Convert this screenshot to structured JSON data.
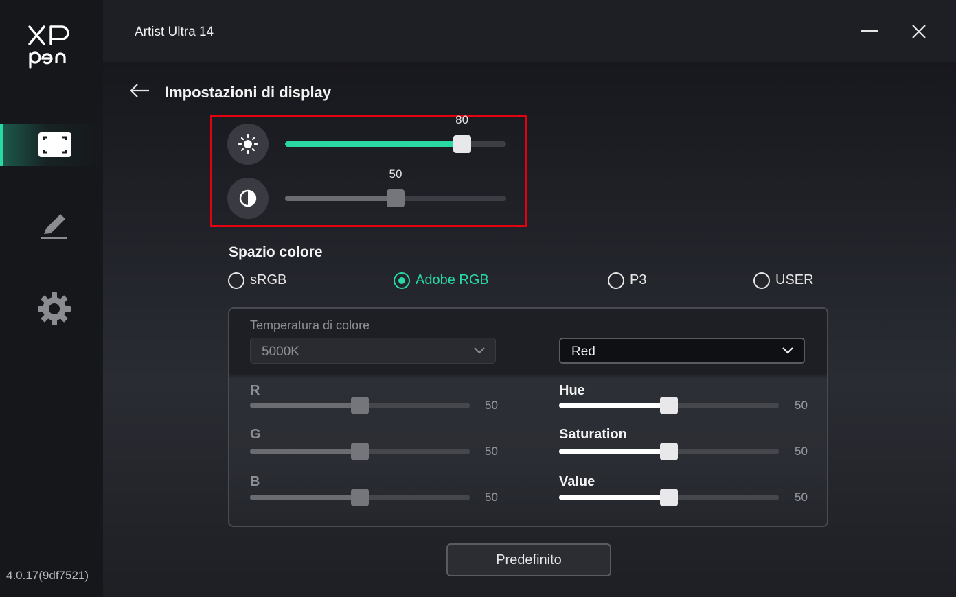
{
  "app": {
    "brand_line1": "XP",
    "brand_line2": "pen",
    "version": "4.0.17(9df7521)",
    "device_title": "Artist Ultra 14"
  },
  "sidebar": {
    "items": [
      {
        "name": "display-settings",
        "icon": "display-frame-icon",
        "active": true
      },
      {
        "name": "pen-settings",
        "icon": "pen-icon",
        "active": false
      },
      {
        "name": "general-settings",
        "icon": "gear-icon",
        "active": false
      }
    ]
  },
  "window_controls": {
    "minimize_icon": "minimize-icon",
    "close_icon": "close-icon"
  },
  "page": {
    "title": "Impostazioni di display",
    "back_icon": "back-arrow-icon"
  },
  "brightness": {
    "icon": "sun-icon",
    "value": 80,
    "value_label": "80",
    "max": 100
  },
  "contrast": {
    "icon": "contrast-icon",
    "value": 50,
    "value_label": "50",
    "max": 100
  },
  "color_space": {
    "title": "Spazio colore",
    "options": [
      {
        "label": "sRGB",
        "selected": false
      },
      {
        "label": "Adobe RGB",
        "selected": true
      },
      {
        "label": "P3",
        "selected": false
      },
      {
        "label": "USER",
        "selected": false
      }
    ]
  },
  "temperature": {
    "label": "Temperatura di colore",
    "value": "5000K"
  },
  "rgb": [
    {
      "label": "R",
      "value": 50,
      "value_label": "50"
    },
    {
      "label": "G",
      "value": 50,
      "value_label": "50"
    },
    {
      "label": "B",
      "value": 50,
      "value_label": "50"
    }
  ],
  "channel": {
    "value": "Red"
  },
  "hsv": [
    {
      "label": "Hue",
      "value": 50,
      "value_label": "50"
    },
    {
      "label": "Saturation",
      "value": 50,
      "value_label": "50"
    },
    {
      "label": "Value",
      "value": 50,
      "value_label": "50"
    }
  ],
  "default_button": "Predefinito",
  "colors": {
    "accent": "#2ad8a6",
    "highlight_border": "#e3000f"
  }
}
